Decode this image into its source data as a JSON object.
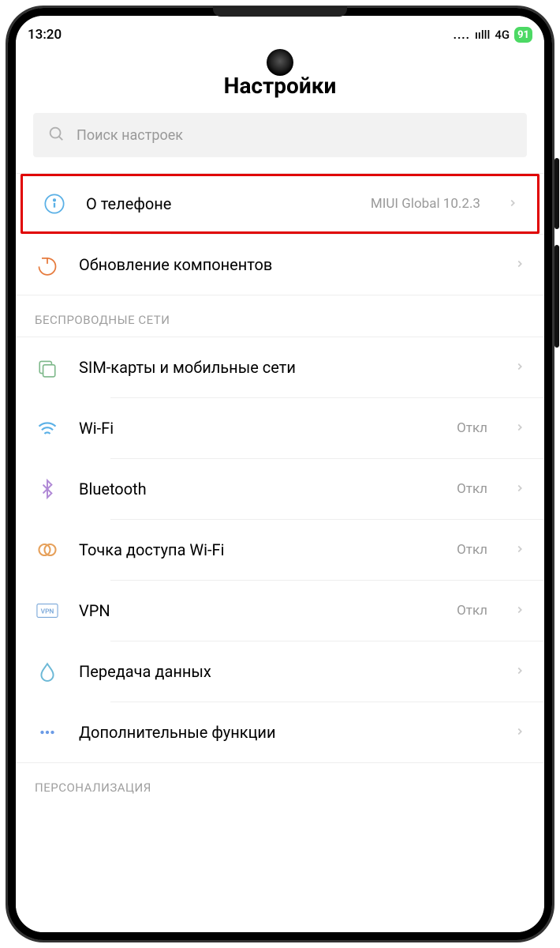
{
  "status": {
    "time": "13:20",
    "dots": "....",
    "signal_label": "ıılll",
    "network": "4G",
    "battery": "91"
  },
  "header": {
    "title": "Настройки"
  },
  "search": {
    "placeholder": "Поиск настроек"
  },
  "sections": {
    "about": {
      "label": "О телефоне",
      "value": "MIUI Global 10.2.3"
    },
    "updates": {
      "label": "Обновление компонентов"
    },
    "wireless_header": "БЕСПРОВОДНЫЕ СЕТИ",
    "sim": {
      "label": "SIM-карты и мобильные сети"
    },
    "wifi": {
      "label": "Wi-Fi",
      "value": "Откл"
    },
    "bluetooth": {
      "label": "Bluetooth",
      "value": "Откл"
    },
    "hotspot": {
      "label": "Точка доступа Wi-Fi",
      "value": "Откл"
    },
    "vpn": {
      "label": "VPN",
      "value": "Откл"
    },
    "data": {
      "label": "Передача данных"
    },
    "more": {
      "label": "Дополнительные функции"
    },
    "personalization_header": "ПЕРСОНАЛИЗАЦИЯ"
  }
}
